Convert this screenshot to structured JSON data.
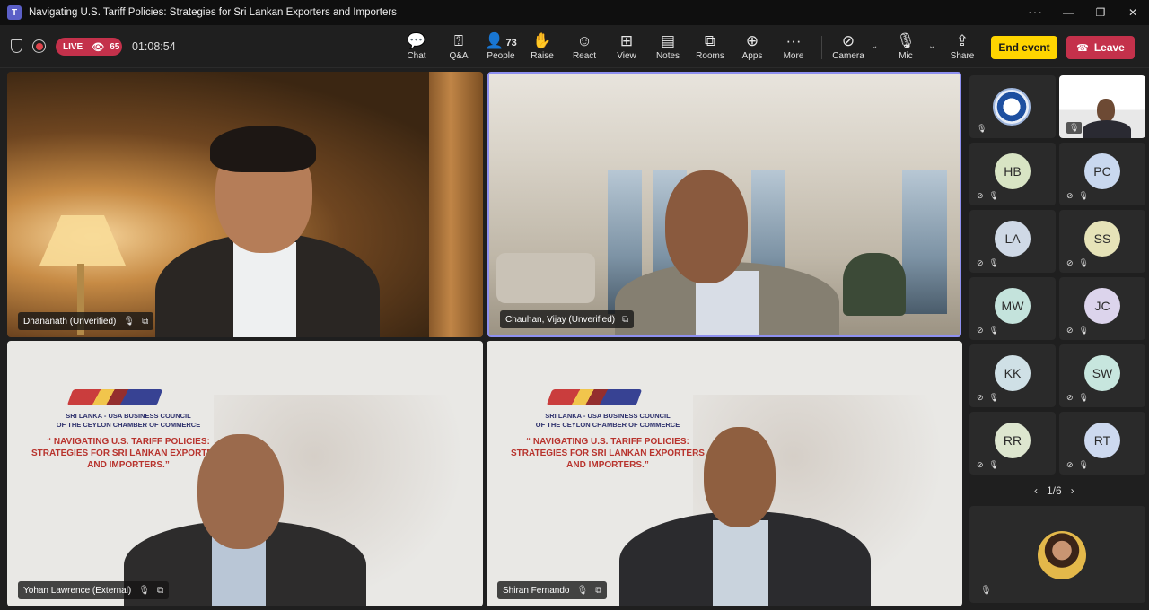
{
  "window": {
    "title": "Navigating U.S. Tariff Policies: Strategies for Sri Lankan Exporters and Importers",
    "more": "···",
    "minimize": "—",
    "maximize": "❐",
    "close": "✕"
  },
  "status": {
    "live_label": "LIVE",
    "viewer_count": "65",
    "timer": "01:08:54"
  },
  "toolbar": {
    "chat": "Chat",
    "qa": "Q&A",
    "people": "People",
    "people_count": "73",
    "raise": "Raise",
    "react": "React",
    "view": "View",
    "notes": "Notes",
    "rooms": "Rooms",
    "apps": "Apps",
    "more": "More",
    "camera": "Camera",
    "mic": "Mic",
    "share": "Share",
    "end_event": "End event",
    "leave": "Leave"
  },
  "main_tiles": [
    {
      "name": "Dhananath (Unverified)"
    },
    {
      "name": "Chauhan, Vijay (Unverified)"
    },
    {
      "name": "Yohan Lawrence (External)"
    },
    {
      "name": "Shiran Fernando"
    }
  ],
  "banner": {
    "org_line1": "SRI LANKA - USA BUSINESS COUNCIL",
    "org_line2": "OF THE CEYLON CHAMBER OF COMMERCE",
    "headline1": "“ NAVIGATING U.S. TARIFF POLICIES:",
    "headline2": "STRATEGIES FOR SRI LANKAN EXPORTERS",
    "headline3": "AND IMPORTERS.”"
  },
  "participants": [
    {
      "initials": "HB",
      "color": "#d8e4c4"
    },
    {
      "initials": "PC",
      "color": "#c9d8ef"
    },
    {
      "initials": "LA",
      "color": "#cfd9e6"
    },
    {
      "initials": "SS",
      "color": "#e6e3b8"
    },
    {
      "initials": "MW",
      "color": "#c4e3dc"
    },
    {
      "initials": "JC",
      "color": "#dcd4ec"
    },
    {
      "initials": "KK",
      "color": "#cfe0e6"
    },
    {
      "initials": "SW",
      "color": "#c7e6de"
    },
    {
      "initials": "RR",
      "color": "#dde6cf"
    },
    {
      "initials": "RT",
      "color": "#cdd9ef"
    }
  ],
  "pager": {
    "label": "1/6",
    "prev": "‹",
    "next": "›"
  }
}
